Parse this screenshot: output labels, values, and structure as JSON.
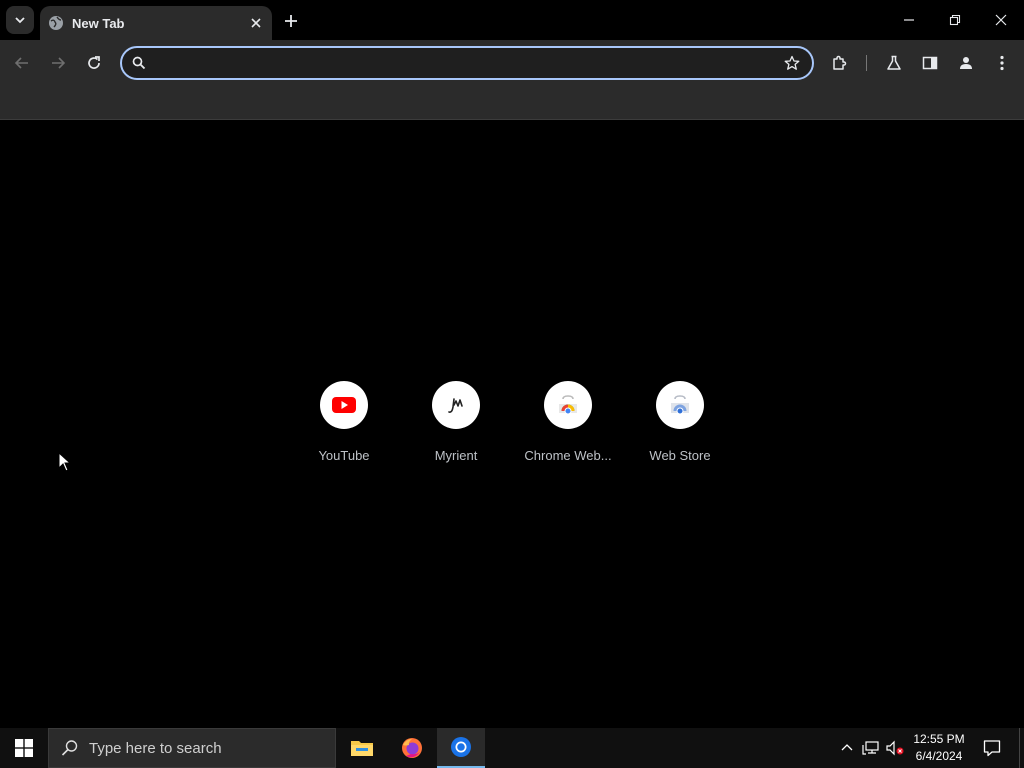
{
  "browser": {
    "tab": {
      "title": "New Tab"
    },
    "omnibox": {
      "value": "",
      "placeholder": ""
    }
  },
  "shortcuts": [
    {
      "label": "YouTube",
      "icon": "youtube-icon"
    },
    {
      "label": "Myrient",
      "icon": "myrient-icon"
    },
    {
      "label": "Chrome Web...",
      "icon": "chrome-web-store-icon"
    },
    {
      "label": "Web Store",
      "icon": "web-store-icon"
    }
  ],
  "taskbar": {
    "search_placeholder": "Type here to search",
    "apps": [
      "file-explorer-icon",
      "firefox-icon",
      "chrome-icon"
    ],
    "time": "12:55 PM",
    "date": "6/4/2024"
  },
  "colors": {
    "tab_bg": "#2b2b2b",
    "toolbar_bg": "#2b2b2b",
    "omnibox_border": "#a8c7fa",
    "page_bg": "#000000",
    "taskbar_bg": "#101010",
    "taskbar_active": "#76b9ed"
  }
}
